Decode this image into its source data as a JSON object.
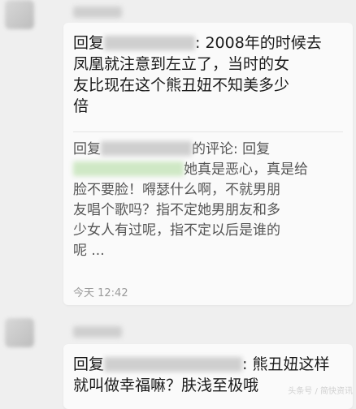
{
  "comments": [
    {
      "reply_prefix": "回复",
      "reply_suffix": ": 2008年的时候去",
      "body_lines": [
        "凤凰就注意到左立了，当时的女",
        "友比现在这个熊丑妞不知美多少",
        "倍"
      ],
      "quoted": {
        "line1_prefix": "回复",
        "line1_suffix": "的评论: 回复",
        "line2_suffix": "她真是恶心，真是给",
        "lines": [
          "脸不要脸！嘚瑟什么啊，不就男朋",
          "友唱个歌吗？指不定她男朋友和多",
          "少女人有过呢，指不定以后是谁的",
          "呢 ..."
        ]
      },
      "time": "今天 12:42"
    },
    {
      "reply_prefix": "回复",
      "reply_suffix": ": 熊丑妞这样",
      "body_lines": [
        "就叫做幸福嘛？肤浅至极哦"
      ]
    }
  ],
  "watermark": "头条号 / 简快资讯"
}
